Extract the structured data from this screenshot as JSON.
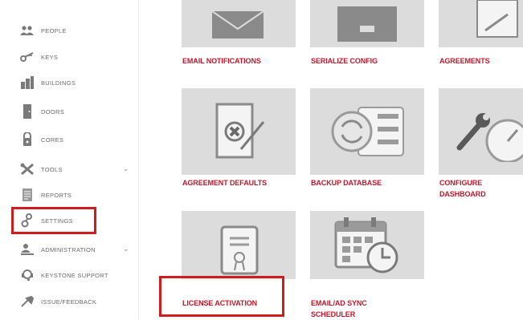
{
  "sidebar": {
    "items": [
      {
        "label": "PEOPLE",
        "icon": "people-icon",
        "has_submenu": false
      },
      {
        "label": "KEYS",
        "icon": "keys-icon",
        "has_submenu": false
      },
      {
        "label": "BUILDINGS",
        "icon": "buildings-icon",
        "has_submenu": false
      },
      {
        "label": "DOORS",
        "icon": "door-icon",
        "has_submenu": false
      },
      {
        "label": "CORES",
        "icon": "lock-core-icon",
        "has_submenu": false
      },
      {
        "label": "TOOLS",
        "icon": "tools-icon",
        "has_submenu": true
      },
      {
        "label": "REPORTS",
        "icon": "report-icon",
        "has_submenu": false
      },
      {
        "label": "SETTINGS",
        "icon": "settings-icon",
        "has_submenu": false,
        "highlighted": true
      },
      {
        "label": "ADMINISTRATION",
        "icon": "administration-icon",
        "has_submenu": true
      },
      {
        "label": "KEYSTONE SUPPORT",
        "icon": "support-icon",
        "has_submenu": false
      },
      {
        "label": "ISSUE/FEEDBACK",
        "icon": "feedback-icon",
        "has_submenu": false
      }
    ]
  },
  "tiles": [
    {
      "label": "EMAIL NOTIFICATIONS",
      "icon": "email-icon"
    },
    {
      "label": "SERIALIZE CONFIG",
      "icon": "serialize-icon"
    },
    {
      "label": "AGREEMENTS",
      "icon": "agreement-icon"
    },
    {
      "label": "AGREEMENT DEFAULTS",
      "icon": "agreement-defaults-icon"
    },
    {
      "label": "BACKUP DATABASE",
      "icon": "backup-database-icon"
    },
    {
      "label": "CONFIGURE DASHBOARD",
      "icon": "configure-dashboard-icon"
    },
    {
      "label": "LICENSE ACTIVATION",
      "icon": "license-icon",
      "highlighted": true
    },
    {
      "label": "EMAIL/AD SYNC SCHEDULER",
      "icon": "calendar-clock-icon"
    }
  ],
  "colors": {
    "accent": "#c4162a",
    "highlight": "#d01c1c",
    "tile_bg": "#dcdcdc",
    "icon": "#7a7a7a"
  }
}
